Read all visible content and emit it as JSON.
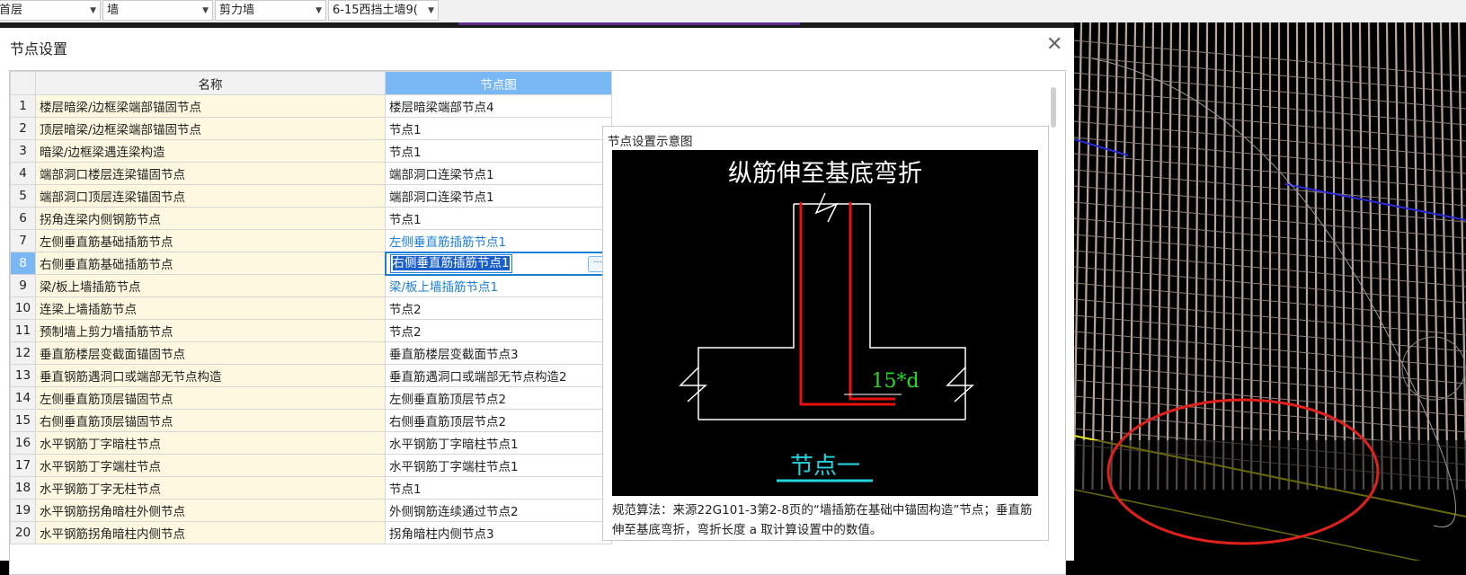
{
  "toolbar": {
    "combos": [
      {
        "value": "首层"
      },
      {
        "value": "墙"
      },
      {
        "value": "剪力墙"
      },
      {
        "value": "6-15西挡土墙9("
      }
    ]
  },
  "dialog": {
    "title": "节点设置",
    "columns": {
      "name": "名称",
      "node": "节点图"
    },
    "rows": [
      {
        "num": "1",
        "name": "楼层暗梁/边框梁端部锚固节点",
        "node": "楼层暗梁端部节点4"
      },
      {
        "num": "2",
        "name": "顶层暗梁/边框梁端部锚固节点",
        "node": "节点1"
      },
      {
        "num": "3",
        "name": "暗梁/边框梁遇连梁构造",
        "node": "节点1"
      },
      {
        "num": "4",
        "name": "端部洞口楼层连梁锚固节点",
        "node": "端部洞口连梁节点1"
      },
      {
        "num": "5",
        "name": "端部洞口顶层连梁锚固节点",
        "node": "端部洞口连梁节点1"
      },
      {
        "num": "6",
        "name": "拐角连梁内侧钢筋节点",
        "node": "节点1"
      },
      {
        "num": "7",
        "name": "左侧垂直筋基础插筋节点",
        "node": "左侧垂直筋插筋节点1"
      },
      {
        "num": "8",
        "name": "右侧垂直筋基础插筋节点",
        "node": "右侧垂直筋插筋节点1"
      },
      {
        "num": "9",
        "name": "梁/板上墙插筋节点",
        "node": "梁/板上墙插筋节点1"
      },
      {
        "num": "10",
        "name": "连梁上墙插筋节点",
        "node": "节点2"
      },
      {
        "num": "11",
        "name": "预制墙上剪力墙插筋节点",
        "node": "节点2"
      },
      {
        "num": "12",
        "name": "垂直筋楼层变截面锚固节点",
        "node": "垂直筋楼层变截面节点3"
      },
      {
        "num": "13",
        "name": "垂直钢筋遇洞口或端部无节点构造",
        "node": "垂直筋遇洞口或端部无节点构造2"
      },
      {
        "num": "14",
        "name": "左侧垂直筋顶层锚固节点",
        "node": "左侧垂直筋顶层节点2"
      },
      {
        "num": "15",
        "name": "右侧垂直筋顶层锚固节点",
        "node": "右侧垂直筋顶层节点2"
      },
      {
        "num": "16",
        "name": "水平钢筋丁字暗柱节点",
        "node": "水平钢筋丁字暗柱节点1"
      },
      {
        "num": "17",
        "name": "水平钢筋丁字端柱节点",
        "node": "水平钢筋丁字端柱节点1"
      },
      {
        "num": "18",
        "name": "水平钢筋丁字无柱节点",
        "node": "节点1"
      },
      {
        "num": "19",
        "name": "水平钢筋拐角暗柱外侧节点",
        "node": "外侧钢筋连续通过节点2"
      },
      {
        "num": "20",
        "name": "水平钢筋拐角暗柱内侧节点",
        "node": "拐角暗柱内侧节点3"
      }
    ],
    "edit_button": "···",
    "diagram": {
      "panel_title": "节点设置示意图",
      "heading": "纵筋伸至基底弯折",
      "dimension": "15*d",
      "caption": "节点一",
      "description": "规范算法：来源22G101-3第2-8页的“墙插筋在基础中锚固构造”节点；垂直筋伸至基底弯折，弯折长度 a 取计算设置中的数值。"
    }
  }
}
